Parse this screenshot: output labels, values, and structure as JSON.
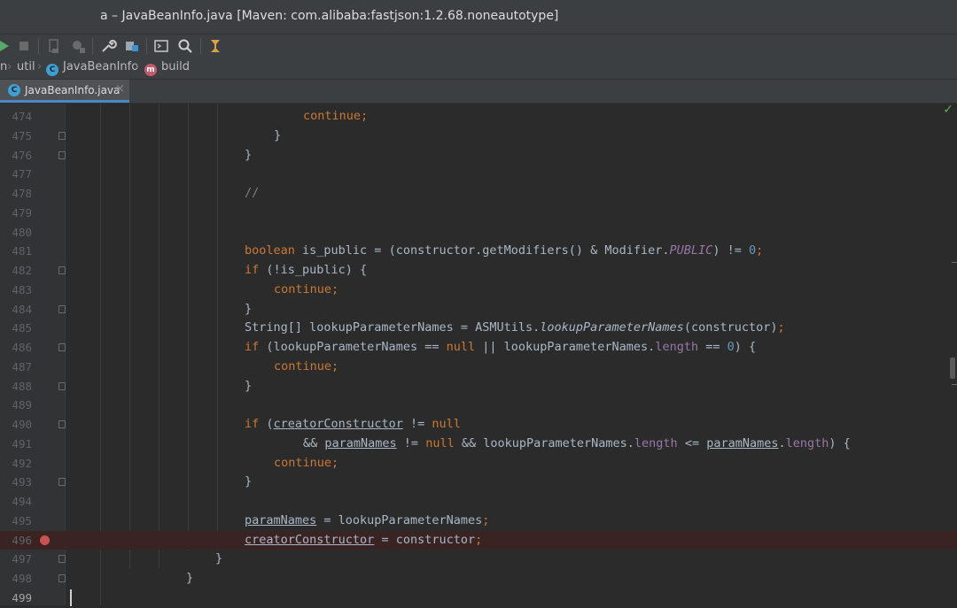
{
  "window": {
    "title": "a – JavaBeanInfo.java [Maven: com.alibaba:fastjson:1.2.68.noneautotype]"
  },
  "toolbar": {
    "icons": [
      "run-icon",
      "stop-icon",
      "build-icon",
      "debug-icon",
      "wrench-icon",
      "project-structure-icon",
      "terminal-icon",
      "search-icon",
      "vcs-icon"
    ]
  },
  "breadcrumbs": {
    "items": [
      {
        "label": "n"
      },
      {
        "label": "util"
      },
      {
        "label": "JavaBeanInfo",
        "icon": "C"
      },
      {
        "label": "build",
        "icon": "m"
      }
    ]
  },
  "tabs": [
    {
      "label": "JavaBeanInfo.java",
      "icon": "C",
      "active": true
    }
  ],
  "colors": {
    "keyword": "#cc7832",
    "number": "#6897bb",
    "field": "#9876aa",
    "comment": "#808080",
    "text": "#a9b7c6",
    "breakpoint": "#c75450"
  },
  "editor": {
    "lines": [
      {
        "num": "474",
        "code": "continue;"
      },
      {
        "num": "475",
        "code": "}"
      },
      {
        "num": "476",
        "code": "}"
      },
      {
        "num": "477",
        "code": ""
      },
      {
        "num": "478",
        "code": "//"
      },
      {
        "num": "479",
        "code": ""
      },
      {
        "num": "480",
        "code": ""
      },
      {
        "num": "481",
        "code": "boolean is_public = (constructor.getModifiers() & Modifier.PUBLIC) != 0;"
      },
      {
        "num": "482",
        "code": "if (!is_public) {"
      },
      {
        "num": "483",
        "code": "continue;"
      },
      {
        "num": "484",
        "code": "}"
      },
      {
        "num": "485",
        "code": "String[] lookupParameterNames = ASMUtils.lookupParameterNames(constructor);"
      },
      {
        "num": "486",
        "code": "if (lookupParameterNames == null || lookupParameterNames.length == 0) {"
      },
      {
        "num": "487",
        "code": "continue;"
      },
      {
        "num": "488",
        "code": "}"
      },
      {
        "num": "489",
        "code": ""
      },
      {
        "num": "490",
        "code": "if (creatorConstructor != null"
      },
      {
        "num": "491",
        "code": "&& paramNames != null && lookupParameterNames.length <= paramNames.length) {"
      },
      {
        "num": "492",
        "code": "continue;"
      },
      {
        "num": "493",
        "code": "}"
      },
      {
        "num": "494",
        "code": ""
      },
      {
        "num": "495",
        "code": "paramNames = lookupParameterNames;"
      },
      {
        "num": "496",
        "code": "creatorConstructor = constructor;"
      },
      {
        "num": "497",
        "code": "}"
      },
      {
        "num": "498",
        "code": "}"
      },
      {
        "num": "499",
        "code": ""
      }
    ]
  }
}
